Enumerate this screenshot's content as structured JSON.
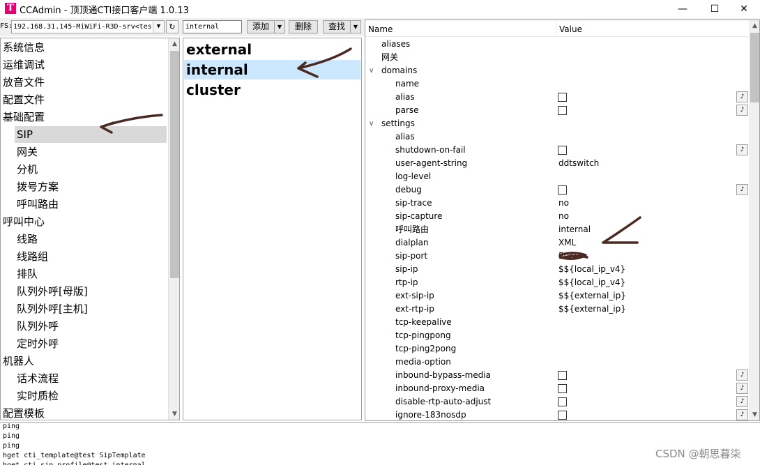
{
  "window": {
    "title": "CCAdmin - 顶顶通CTI接口客户端 1.0.13",
    "icon_letter": "T",
    "controls": {
      "minimize": "—",
      "maximize": "☐",
      "close": "✕"
    }
  },
  "toolbar": {
    "fs_label": "FS:",
    "fs_value": "192.168.31.145-MiWiFi-R3D-srv<tes",
    "search_value": "internal",
    "add_label": "添加",
    "delete_label": "删除",
    "find_label": "查找"
  },
  "tree": {
    "items": [
      {
        "label": "系统信息",
        "level": 0
      },
      {
        "label": "运维调试",
        "level": 0
      },
      {
        "label": "放音文件",
        "level": 0
      },
      {
        "label": "配置文件",
        "level": 0
      },
      {
        "label": "基础配置",
        "level": 0
      },
      {
        "label": "SIP",
        "level": 1,
        "selected": true
      },
      {
        "label": "网关",
        "level": 1
      },
      {
        "label": "分机",
        "level": 1
      },
      {
        "label": "拨号方案",
        "level": 1
      },
      {
        "label": "呼叫路由",
        "level": 1
      },
      {
        "label": "呼叫中心",
        "level": 0
      },
      {
        "label": "线路",
        "level": 1
      },
      {
        "label": "线路组",
        "level": 1
      },
      {
        "label": "排队",
        "level": 1
      },
      {
        "label": "队列外呼[母版]",
        "level": 1
      },
      {
        "label": "队列外呼[主机]",
        "level": 1
      },
      {
        "label": "队列外呼",
        "level": 1
      },
      {
        "label": "定时外呼",
        "level": 1
      },
      {
        "label": "机器人",
        "level": 0
      },
      {
        "label": "话术流程",
        "level": 1
      },
      {
        "label": "实时质检",
        "level": 1
      },
      {
        "label": "配置模板",
        "level": 0
      }
    ]
  },
  "profiles": {
    "items": [
      {
        "label": "external"
      },
      {
        "label": "internal",
        "selected": true
      },
      {
        "label": "cluster"
      }
    ]
  },
  "props": {
    "col_name": "Name",
    "col_value": "Value",
    "rows": [
      {
        "name": "aliases",
        "indent": 1
      },
      {
        "name": "网关",
        "indent": 1
      },
      {
        "name": "domains",
        "indent": 1,
        "expander": "∨"
      },
      {
        "name": "name",
        "indent": 2
      },
      {
        "name": "alias",
        "indent": 2,
        "check": true,
        "edit": true
      },
      {
        "name": "parse",
        "indent": 2,
        "check": true,
        "edit": true
      },
      {
        "name": "settings",
        "indent": 1,
        "expander": "∨"
      },
      {
        "name": "alias",
        "indent": 2
      },
      {
        "name": "shutdown-on-fail",
        "indent": 2,
        "check": true,
        "edit": true
      },
      {
        "name": "user-agent-string",
        "indent": 2,
        "value": "ddtswitch"
      },
      {
        "name": "log-level",
        "indent": 2
      },
      {
        "name": "debug",
        "indent": 2,
        "check": true,
        "edit": true
      },
      {
        "name": "sip-trace",
        "indent": 2,
        "value": "no"
      },
      {
        "name": "sip-capture",
        "indent": 2,
        "value": "no"
      },
      {
        "name": "呼叫路由",
        "indent": 2,
        "value": "internal"
      },
      {
        "name": "dialplan",
        "indent": 2,
        "value": "XML"
      },
      {
        "name": "sip-port",
        "indent": 2,
        "value": "5060",
        "scribbled": true
      },
      {
        "name": "sip-ip",
        "indent": 2,
        "value": "$${local_ip_v4}"
      },
      {
        "name": "rtp-ip",
        "indent": 2,
        "value": "$${local_ip_v4}"
      },
      {
        "name": "ext-sip-ip",
        "indent": 2,
        "value": "$${external_ip}"
      },
      {
        "name": "ext-rtp-ip",
        "indent": 2,
        "value": "$${external_ip}"
      },
      {
        "name": "tcp-keepalive",
        "indent": 2
      },
      {
        "name": "tcp-pingpong",
        "indent": 2
      },
      {
        "name": "tcp-ping2pong",
        "indent": 2
      },
      {
        "name": "media-option",
        "indent": 2
      },
      {
        "name": "inbound-bypass-media",
        "indent": 2,
        "check": true,
        "edit": true
      },
      {
        "name": "inbound-proxy-media",
        "indent": 2,
        "check": true,
        "edit": true
      },
      {
        "name": "disable-rtp-auto-adjust",
        "indent": 2,
        "check": true,
        "edit": true
      },
      {
        "name": "ignore-183nosdp",
        "indent": 2,
        "check": true,
        "edit": true
      }
    ]
  },
  "log": {
    "lines": [
      "ping",
      "ping",
      "ping",
      "hget cti_template@test SipTemplate",
      "hget cti_sip_profile@test internal"
    ]
  },
  "watermark": "CSDN @朝思暮柒",
  "colors": {
    "selected_row": "#cce8ff",
    "tree_selected": "#d9d9d9",
    "annotation_ink": "#4a2a22",
    "brand": "#e20074"
  }
}
